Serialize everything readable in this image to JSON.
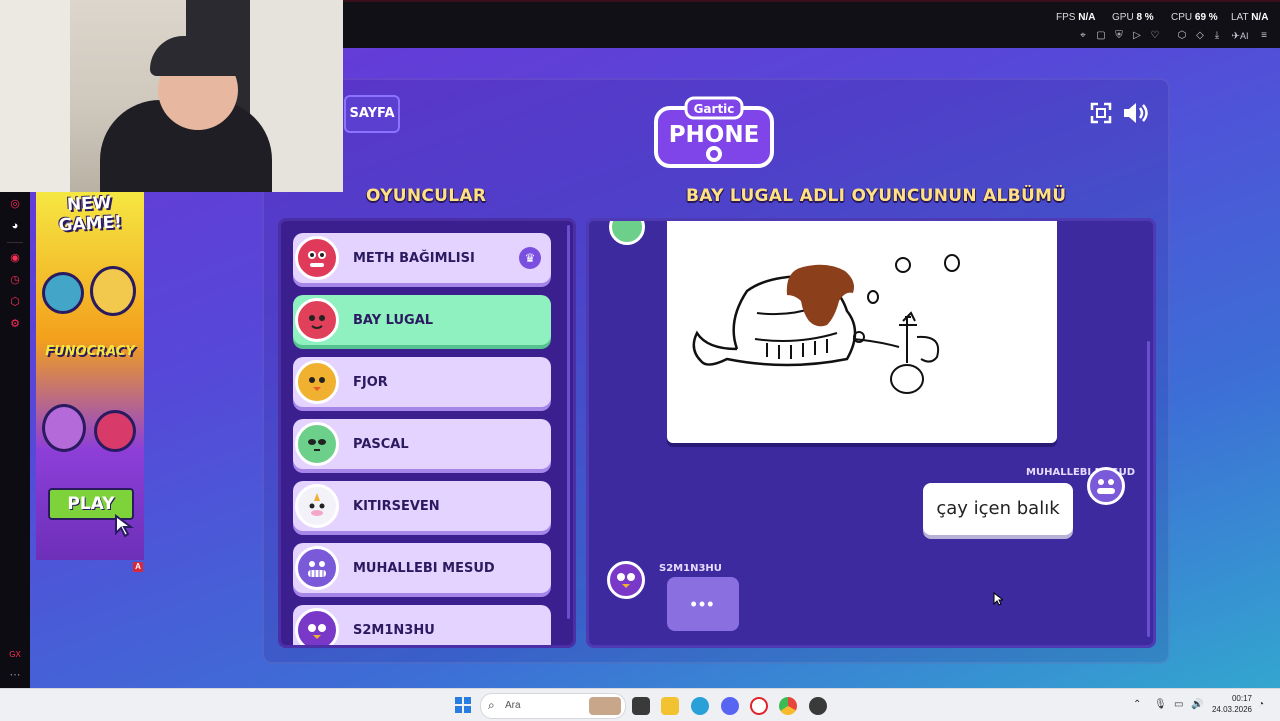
{
  "overlay": {
    "stats": [
      {
        "label": "FPS",
        "value": "N/A"
      },
      {
        "label": "GPU",
        "value": "8 %"
      },
      {
        "label": "CPU",
        "value": "69 %"
      },
      {
        "label": "LAT",
        "value": "N/A"
      }
    ],
    "toolbar_icons": [
      "pin-icon",
      "snapshot-icon",
      "shield-icon",
      "play-icon",
      "heart-icon",
      "extensions-icon",
      "cube-icon",
      "download-icon",
      "send-icon",
      "ai-icon",
      "menu-icon"
    ],
    "ai_label": "AI"
  },
  "sidebar": {
    "icons": [
      "instagram-icon",
      "discord-icon",
      "player-icon",
      "history-icon",
      "extensions-icon",
      "settings-icon"
    ],
    "footer": "GX"
  },
  "ad": {
    "headline": "NEW GAME!",
    "brand": "FUNOCRACY",
    "play_label": "PLAY",
    "badge": "A"
  },
  "game": {
    "page_button": "SAYFA",
    "logo_top": "Gartic",
    "logo_bottom": "PHONE",
    "players_title": "OYUNCULAR",
    "album_title": "BAY LUGAL ADLI OYUNCUNUN ALBÜMÜ",
    "players": [
      {
        "name": "METH BAĞIMLISI",
        "host": true,
        "color": "#e03a5a"
      },
      {
        "name": "BAY LUGAL",
        "active": true,
        "color": "#e0405a"
      },
      {
        "name": "FJOR",
        "color": "#f0b030"
      },
      {
        "name": "PASCAL",
        "color": "#6cd08a"
      },
      {
        "name": "KITIRSEVEN",
        "color": "#f2f2f8"
      },
      {
        "name": "MUHALLEBI MESUD",
        "color": "#7a5ad8"
      },
      {
        "name": "S2M1N3HU",
        "color": "#7a38c8"
      }
    ],
    "album": {
      "guess_author": "MUHALLEBI MESUD",
      "guess_text": "çay içen balık",
      "typing_author": "S2M1N3HU",
      "typing_indicator": "•••"
    }
  },
  "taskbar": {
    "search_placeholder": "Ara",
    "time": "00:17",
    "date": "24.03.2026"
  }
}
